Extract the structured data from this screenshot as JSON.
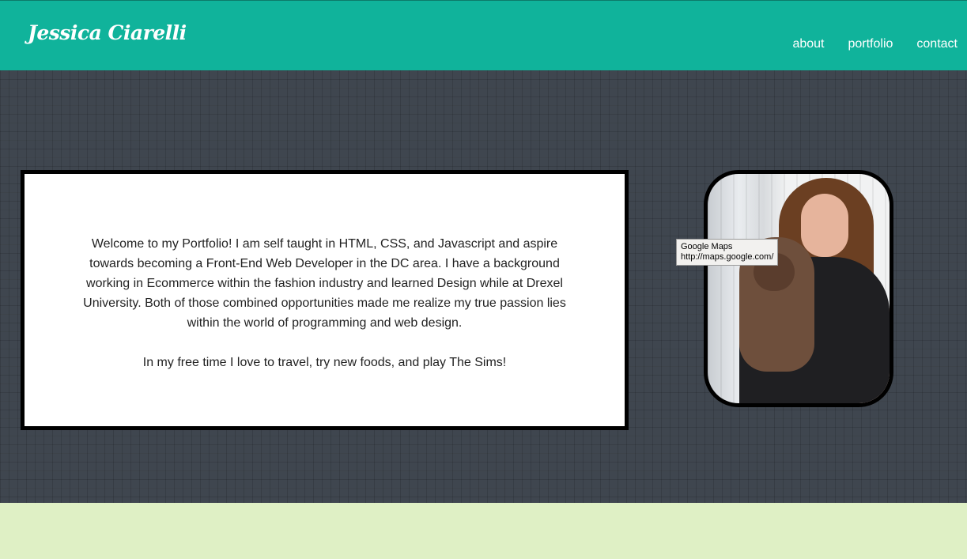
{
  "header": {
    "brand": "Jessica Ciarelli",
    "nav": [
      {
        "label": "about"
      },
      {
        "label": "portfolio"
      },
      {
        "label": "contact"
      }
    ]
  },
  "intro": {
    "paragraph1": "Welcome to my Portfolio! I am self taught in HTML, CSS, and Javascript and aspire towards becoming a Front-End Web Developer in the DC area. I have a background working in Ecommerce within the fashion industry and learned Design while at Drexel University. Both of those combined opportunities made me realize my true passion lies within the world of programming and web design.",
    "paragraph2": "In my free time I love to travel, try new foods, and play The Sims!"
  },
  "photo": {
    "subject": "portrait-with-dog"
  },
  "tooltip": {
    "title": "Google Maps",
    "url": "http://maps.google.com/"
  },
  "colors": {
    "header_bg": "#10b39b",
    "hero_bg": "#3f464f",
    "lower_bg": "#dff0c5"
  }
}
